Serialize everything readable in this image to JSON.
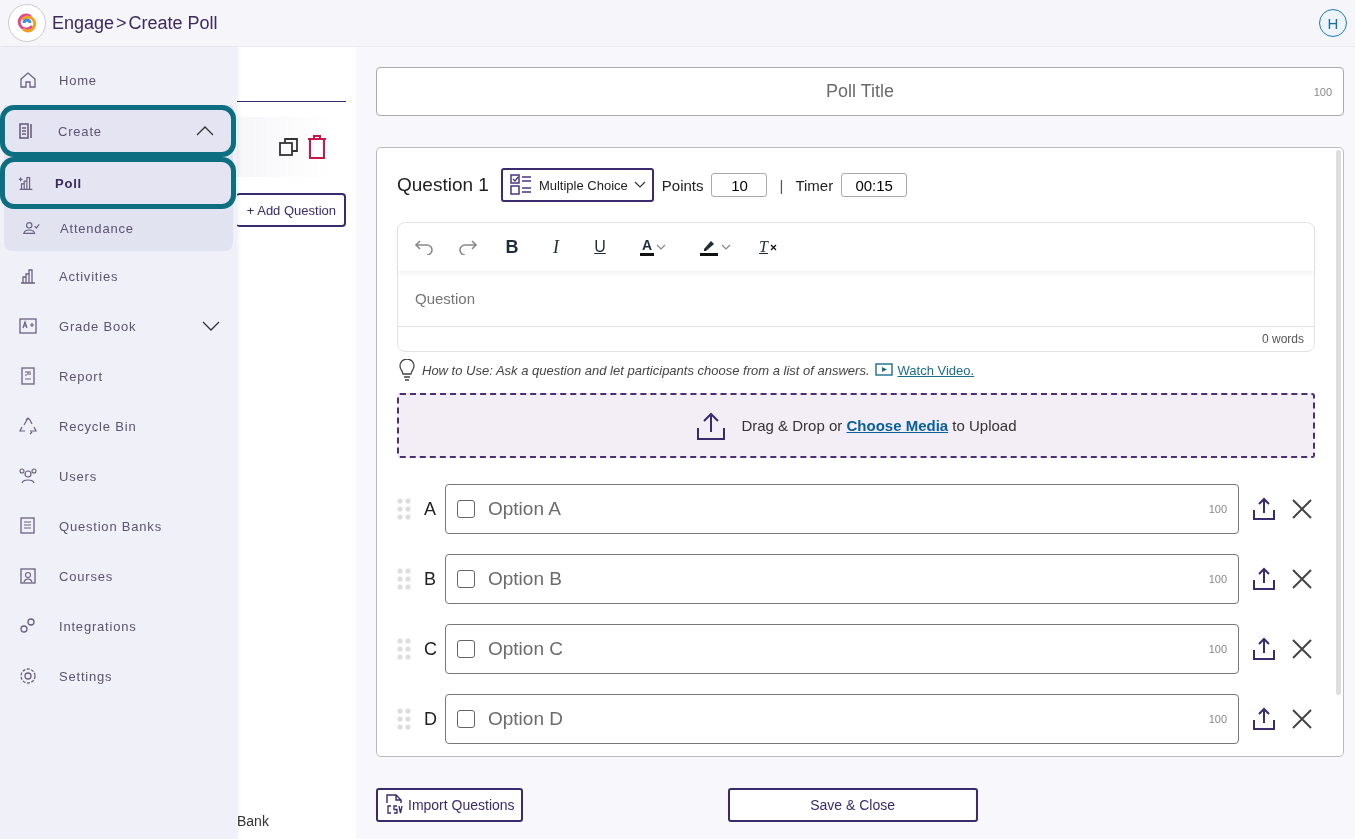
{
  "header": {
    "app": "Engage",
    "separator": ">",
    "page": "Create Poll",
    "avatar": "H"
  },
  "sidebar": {
    "items": [
      {
        "label": "Home",
        "selected": false,
        "highlighted": false
      },
      {
        "label": "Create",
        "selected": false,
        "highlighted": true,
        "expanded": true,
        "children": [
          {
            "label": "Poll",
            "selected": true,
            "highlighted": true
          },
          {
            "label": "Attendance",
            "selected": false,
            "highlighted": false
          }
        ]
      },
      {
        "label": "Activities",
        "selected": false,
        "highlighted": false
      },
      {
        "label": "Grade Book",
        "selected": false,
        "highlighted": false,
        "expanded": false
      },
      {
        "label": "Report",
        "selected": false,
        "highlighted": false
      },
      {
        "label": "Recycle Bin",
        "selected": false,
        "highlighted": false
      },
      {
        "label": "Users",
        "selected": false,
        "highlighted": false
      },
      {
        "label": "Question Banks",
        "selected": false,
        "highlighted": false
      },
      {
        "label": "Courses",
        "selected": false,
        "highlighted": false
      },
      {
        "label": "Integrations",
        "selected": false,
        "highlighted": false
      },
      {
        "label": "Settings",
        "selected": false,
        "highlighted": false
      }
    ]
  },
  "question_panel": {
    "add_button": "+ Add Question",
    "bottom_text": "Bank"
  },
  "poll_title": {
    "placeholder": "Poll Title",
    "limit": "100"
  },
  "question": {
    "label": "Question 1",
    "type": "Multiple Choice",
    "points_label": "Points",
    "points": "10",
    "divider": "|",
    "timer_label": "Timer",
    "timer": "00:15",
    "toolbar": [
      {
        "kind": "undo"
      },
      {
        "kind": "redo"
      },
      {
        "kind": "bold",
        "label": "B"
      },
      {
        "kind": "italic",
        "label": "I"
      },
      {
        "kind": "underline",
        "label": "U"
      },
      {
        "kind": "font-color",
        "label": "A"
      },
      {
        "kind": "highlight"
      },
      {
        "kind": "clear-format",
        "label": "T"
      }
    ],
    "placeholder": "Question",
    "word_count": "0 words",
    "hint": "How to Use: Ask a question and let participants choose from a list of answers.",
    "hint_link": "Watch Video.",
    "upload": {
      "before": "Drag & Drop or",
      "link": "Choose Media",
      "after": "to Upload"
    },
    "options": [
      {
        "letter": "A",
        "placeholder": "Option A",
        "limit": "100",
        "checked": false
      },
      {
        "letter": "B",
        "placeholder": "Option B",
        "limit": "100",
        "checked": false
      },
      {
        "letter": "C",
        "placeholder": "Option C",
        "limit": "100",
        "checked": false
      },
      {
        "letter": "D",
        "placeholder": "Option D",
        "limit": "100",
        "checked": false
      }
    ]
  },
  "footer": {
    "import": "Import Questions",
    "save": "Save & Close"
  }
}
